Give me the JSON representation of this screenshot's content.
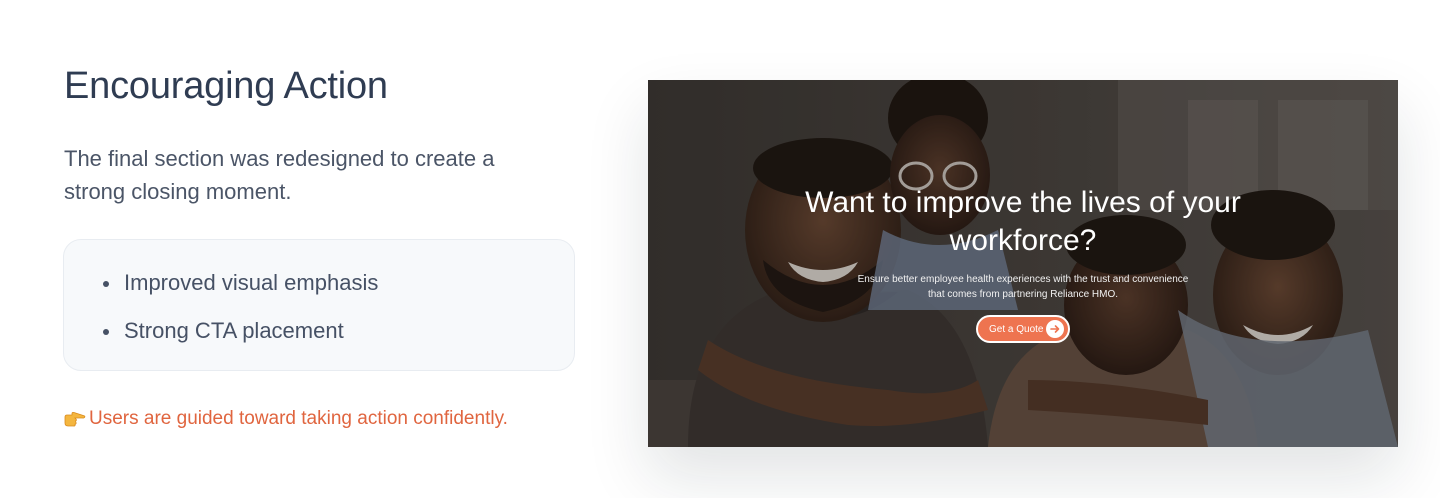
{
  "section": {
    "title": "Encouraging Action",
    "intro": "The final section was redesigned to create a strong closing moment.",
    "points": [
      "Improved visual emphasis",
      "Strong CTA placement"
    ],
    "note_icon": "pointing-hand-icon",
    "note": "Users are guided toward taking action confidently."
  },
  "hero": {
    "title": "Want to improve the lives of your workforce?",
    "subtitle": "Ensure better employee health experiences with the trust and convenience that comes from partnering Reliance HMO.",
    "cta_label": "Get a Quote",
    "cta_icon": "arrow-right-icon"
  },
  "colors": {
    "heading": "#2f3c52",
    "accent": "#e0653f",
    "cta": "#ee7450"
  }
}
